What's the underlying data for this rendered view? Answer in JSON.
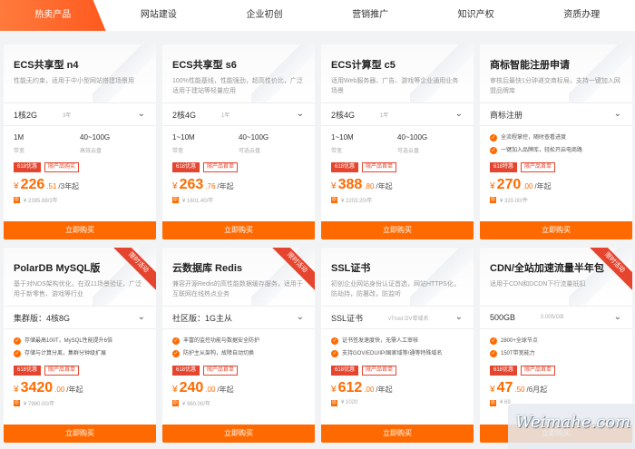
{
  "tabs": [
    "热卖产品",
    "网站建设",
    "企业初创",
    "营销推广",
    "知识产权",
    "资质办理"
  ],
  "active_tab": "热卖产品",
  "cards": [
    {
      "title": "ECS共享型 n4",
      "desc": "性能无约束，适用于中小型网站搭建场景用",
      "ribbon": "",
      "select": "1核2G",
      "select_sub": "3年",
      "specs": [
        {
          "v": "1M",
          "l": "带宽"
        },
        {
          "v": "40~100G",
          "l": "高效云盘"
        }
      ],
      "features": [],
      "badges": [
        "618优惠",
        "限产品购买"
      ],
      "price_int": "226",
      "price_dec": ".51",
      "unit": "/3年起",
      "orig": "¥ 2395.88/3年",
      "buy": "立即购买"
    },
    {
      "title": "ECS共享型 s6",
      "desc": "100%性能基线，性能强劲，超高性价比，广泛适用于建站等轻量应用",
      "ribbon": "",
      "select": "2核4G",
      "select_sub": "1年",
      "specs": [
        {
          "v": "1~10M",
          "l": "带宽"
        },
        {
          "v": "40~100G",
          "l": "可选云盘"
        }
      ],
      "features": [],
      "badges": [
        "618优惠",
        "限产品首单"
      ],
      "price_int": "263",
      "price_dec": ".76",
      "unit": "/年起",
      "orig": "¥ 1601.40/年",
      "buy": "立即购买"
    },
    {
      "title": "ECS计算型 c5",
      "desc": "适用Web服务器、广告、游戏等企业通用业务场景",
      "ribbon": "",
      "select": "2核4G",
      "select_sub": "1年",
      "specs": [
        {
          "v": "1~10M",
          "l": "带宽"
        },
        {
          "v": "40~100G",
          "l": "可选云盘"
        }
      ],
      "features": [],
      "badges": [
        "618优惠",
        "限产品首单"
      ],
      "price_int": "388",
      "price_dec": ".80",
      "unit": "/年起",
      "orig": "¥ 2203.20/年",
      "buy": "立即购买"
    },
    {
      "title": "商标智能注册申请",
      "desc": "审核后最快1分钟递交商标局，支持一键加入网盟品牌库",
      "ribbon": "",
      "select": "商标注册",
      "select_sub": "",
      "specs": [],
      "features": [
        "全流程掌控，随时查看进度",
        "一键加入品牌库，轻松开启电商路"
      ],
      "badges": [
        "618特惠",
        "限产品首单"
      ],
      "price_int": "270",
      "price_dec": ".00",
      "unit": "/年起",
      "orig": "¥ 320.00/件",
      "buy": "立即购买"
    },
    {
      "title": "PolarDB MySQL版",
      "desc": "基于对NDS架构优化，在双11场景验证，广泛用于新零售、游戏等行业",
      "ribbon": "限时活动",
      "select": "集群版：4核8G",
      "select_sub": "",
      "specs": [],
      "features": [
        "存储最高100T，MySQL性能提升6倍",
        "存储与计算分离，集群分钟级扩展"
      ],
      "badges": [
        "618优惠",
        "限产品首单"
      ],
      "price_int": "3420",
      "price_dec": ".00",
      "unit": "/年起",
      "orig": "¥ 7980.00/年",
      "buy": "立即购买"
    },
    {
      "title": "云数据库 Redis",
      "desc": "兼容开源Redis的高性能数据缓存服务，适用于互联网在线热点业务",
      "ribbon": "限时活动",
      "select": "社区版：1G主从",
      "select_sub": "",
      "specs": [],
      "features": [
        "丰富的监控功能与数据安全防护",
        "防护主从架构，故障自动切换"
      ],
      "badges": [
        "618优惠",
        "限产品首单"
      ],
      "price_int": "240",
      "price_dec": ".00",
      "unit": "/年起",
      "orig": "¥ 960.00/年",
      "buy": "立即购买"
    },
    {
      "title": "SSL证书",
      "desc": "初创企业网站身份认证首选，网站HTTPS化，防劫持，防篡改，防监听",
      "ribbon": "",
      "select": "SSL证书",
      "select_sub": "vTrust DV单域名",
      "specs": [],
      "features": [
        "证书签发速度快，无需人工审核",
        "支持GOV/EDU/IP/国家域等/通等特殊域名"
      ],
      "badges": [
        "618优惠",
        "限产品首单"
      ],
      "price_int": "612",
      "price_dec": ".00",
      "unit": "/年起",
      "orig": "¥ 1020",
      "buy": "立即购买"
    },
    {
      "title": "CDN/全站加速流量半年包",
      "desc": "适用于CDN和DCDN下行流量抵扣",
      "ribbon": "限时活动",
      "select": "500GB",
      "select_sub": "0.005/GB",
      "specs": [],
      "features": [
        "2800+全球节点",
        "150T带宽能力"
      ],
      "badges": [
        "618优惠",
        "限产品首单"
      ],
      "price_int": "47",
      "price_dec": ".50",
      "unit": "/6月起",
      "orig": "¥ 69",
      "buy": "立即购买"
    }
  ],
  "watermark": "Weimahe.com"
}
